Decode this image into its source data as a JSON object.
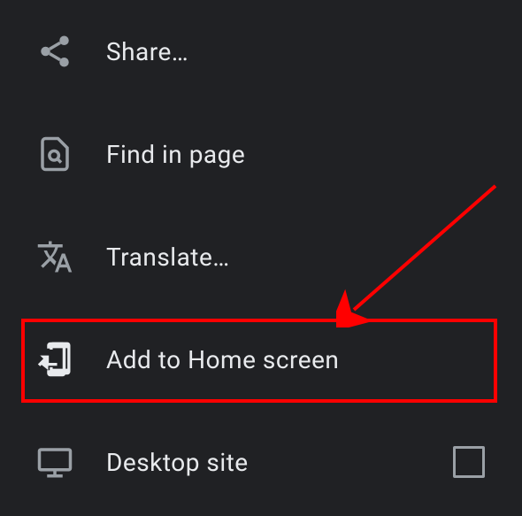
{
  "menu": {
    "items": [
      {
        "label": "Share…"
      },
      {
        "label": "Find in page"
      },
      {
        "label": "Translate…"
      },
      {
        "label": "Add to Home screen"
      },
      {
        "label": "Desktop site"
      }
    ]
  },
  "annotation": {
    "highlighted_item": "Add to Home screen"
  }
}
